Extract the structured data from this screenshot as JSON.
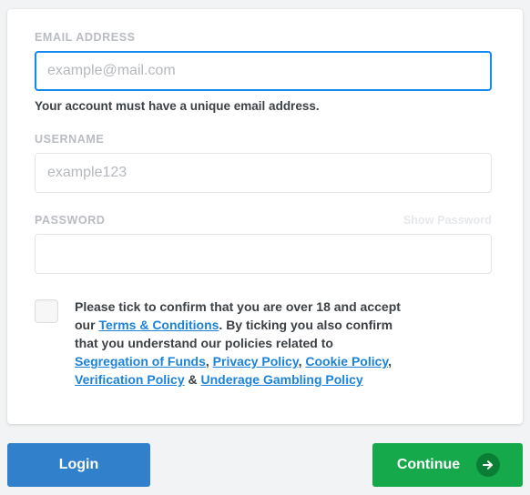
{
  "card": {
    "email": {
      "label": "EMAIL ADDRESS",
      "placeholder": "example@mail.com",
      "value": "",
      "helper": "Your account must have a unique email address.",
      "focused": true,
      "focus_color": "#1189ef"
    },
    "username": {
      "label": "USERNAME",
      "placeholder": "example123",
      "value": ""
    },
    "password": {
      "label": "PASSWORD",
      "placeholder": "",
      "value": "",
      "show_password_label": "Show Password"
    },
    "terms": {
      "checked": false,
      "segments": [
        {
          "text": "Please tick to confirm that you are over 18 and accept our ",
          "link": false
        },
        {
          "text": "Terms & Conditions",
          "link": true
        },
        {
          "text": ". By ticking you also confirm that you understand our policies related to ",
          "link": false
        },
        {
          "text": "Segregation of Funds",
          "link": true
        },
        {
          "text": ", ",
          "link": false
        },
        {
          "text": "Privacy Policy",
          "link": true
        },
        {
          "text": ", ",
          "link": false
        },
        {
          "text": "Cookie Policy",
          "link": true
        },
        {
          "text": ", ",
          "link": false
        },
        {
          "text": "Verification Policy",
          "link": true
        },
        {
          "text": " & ",
          "link": false
        },
        {
          "text": "Underage Gambling Policy",
          "link": true
        }
      ],
      "link_color": "#1b83d9"
    }
  },
  "footer": {
    "login_label": "Login",
    "login_color": "#3080cb",
    "continue_label": "Continue",
    "continue_color": "#16a94b",
    "continue_icon": "arrow-right-icon"
  }
}
